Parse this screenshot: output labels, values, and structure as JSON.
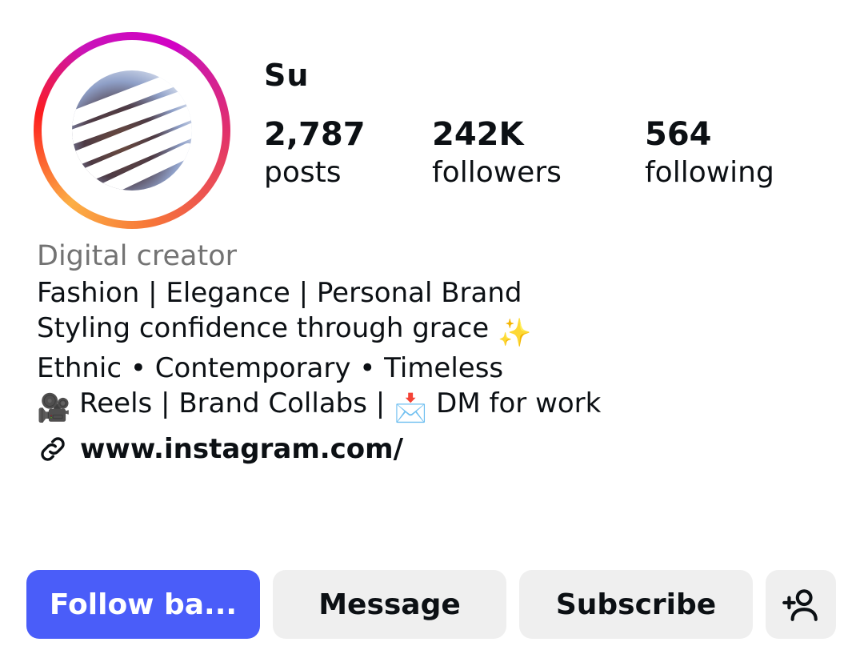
{
  "profile": {
    "username": "Su",
    "stats": {
      "posts_count": "2,787",
      "posts_label": "posts",
      "followers_count": "242K",
      "followers_label": "followers",
      "following_count": "564",
      "following_label": "following"
    },
    "category": "Digital creator",
    "bio": {
      "line1": "Fashion | Elegance | Personal Brand",
      "line2": "Styling confidence through grace ",
      "line2_emoji": "✨",
      "line3": "Ethnic • Contemporary • Timeless",
      "line4_emoji_a": "🎥",
      "line4_a": " Reels | Brand Collabs | ",
      "line4_emoji_b": "📩",
      "line4_b": " DM for work"
    },
    "link": "www.instagram.com/"
  },
  "actions": {
    "follow_back_label": "Follow ba...",
    "message_label": "Message",
    "subscribe_label": "Subscribe"
  },
  "icons": {
    "link": "link-icon",
    "add_user": "add-person-icon"
  },
  "colors": {
    "primary_button": "#4a5df9",
    "secondary_button": "#efefef",
    "category_text": "#737373"
  }
}
